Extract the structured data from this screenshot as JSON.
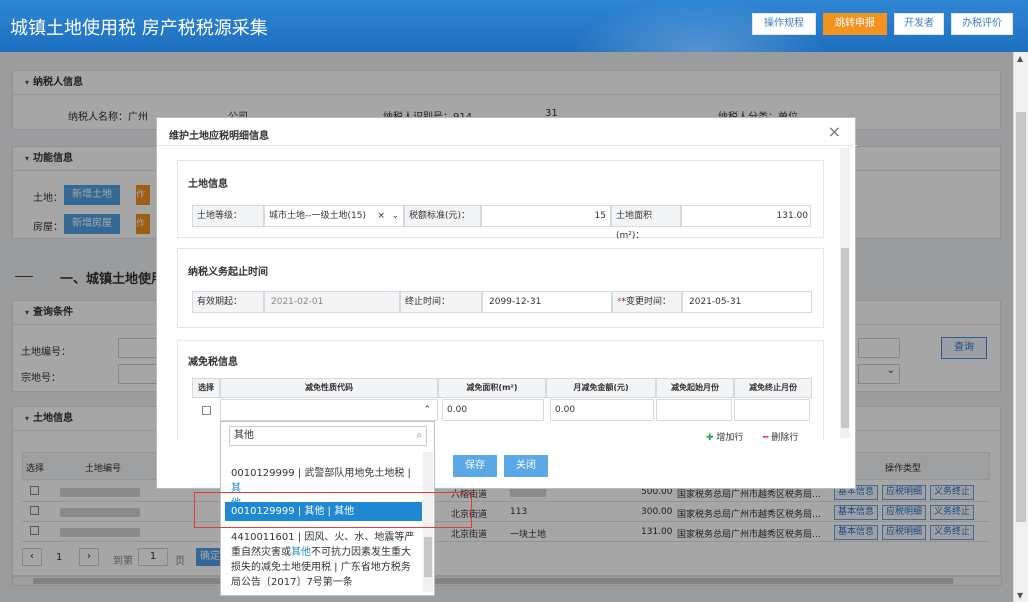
{
  "header": {
    "title": "城镇土地使用税 房产税税源采集",
    "buttons": [
      "操作规程",
      "跳转申报",
      "开发者",
      "办税评价"
    ]
  },
  "taxpayer": {
    "section_title": "纳税人信息",
    "name_label": "纳税人名称：广州",
    "name_tail": "公司",
    "id_label": "纳税人识别号：914",
    "id_tail": "31",
    "category": "纳税人分类：单位"
  },
  "functions": {
    "section_title": "功能信息",
    "land_label": "土地：",
    "land_btn": "新增土地",
    "house_label": "房屋：",
    "house_btn": "新增房屋",
    "orange_glyph": "作"
  },
  "main_heading": "一、城镇土地使用税",
  "query": {
    "section_title": "查询条件",
    "land_no": "土地编号：",
    "parcel_no": "宗地号：",
    "btn": "查询"
  },
  "land_info": {
    "section_title": "土地信息",
    "col_select": "选择",
    "col_land_no": "土地编号",
    "col_ops": "操作类型",
    "rows": [
      {
        "street": "六榕街道",
        "area": "500.00",
        "org": "国家税务总局广州市越秀区税务局…"
      },
      {
        "street": "北京街道",
        "mid": "113",
        "area": "300.00",
        "org": "国家税务总局广州市越秀区税务局…"
      },
      {
        "street": "北京街道",
        "mid": "一块土地",
        "area": "131.00",
        "org": "国家税务总局广州市越秀区税务局…"
      }
    ],
    "op_buttons": [
      "基本信息",
      "应税明细",
      "义务终止"
    ]
  },
  "pager": {
    "page": "1",
    "goto_label": "到第",
    "goto_val": "1",
    "page_unit": "页",
    "confirm": "确定"
  },
  "modal": {
    "title": "维护土地应税明细信息",
    "close": "×",
    "land_section": {
      "title": "土地信息",
      "grade_label": "土地等级：",
      "grade_value": "城市土地--一级土地(15)",
      "rate_label": "税额标准(元)：",
      "rate_value": "15",
      "area_label": "土地面积(m²)：",
      "area_value": "131.00"
    },
    "period_section": {
      "title": "纳税义务起止时间",
      "start_label": "有效期起：",
      "start_value": "2021-02-01",
      "end_label": "终止时间：",
      "end_value": "2099-12-31",
      "change_label": "*变更时间：",
      "change_value": "2021-05-31"
    },
    "relief_section": {
      "title": "减免税信息",
      "headers": [
        "选择",
        "减免性质代码",
        "减免面积(m²)",
        "月减免金额(元)",
        "减免起始月份",
        "减免终止月份"
      ],
      "area_value": "0.00",
      "amount_value": "0.00",
      "add_row": "增加行",
      "del_row": "删除行"
    },
    "save": "保存",
    "close_btn": "关闭"
  },
  "dropdown": {
    "search": "其他",
    "opt1": {
      "a": "0010129999 | 武警部队用地免土地税 | ",
      "b": "其",
      "c": "他"
    },
    "opt2": "0010129999 | 其他 | 其他",
    "opt3": {
      "a": "4410011601 | 因风、火、水、地震等严重自然灾害或",
      "hl": "其他",
      "b": "不可抗力因素发生重大损失的减免土地使用税 | 广东省地方税务局公告〔2017〕7号第一条"
    }
  }
}
